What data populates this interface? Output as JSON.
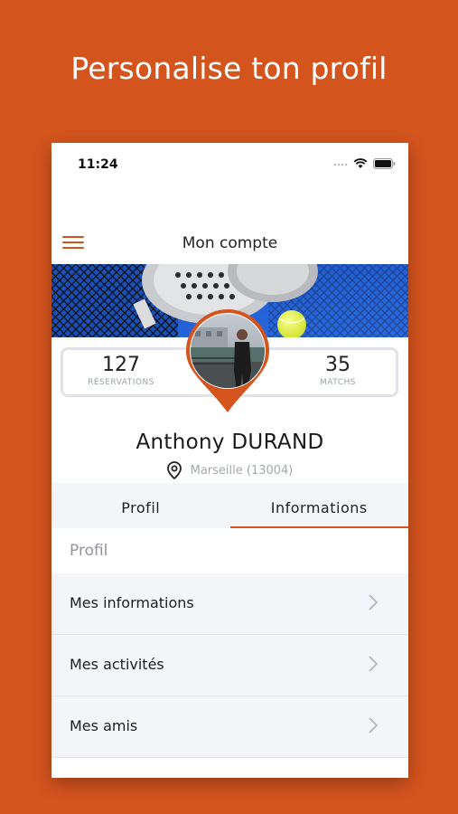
{
  "headline": "Personalise ton profil",
  "status_bar": {
    "time": "11:24"
  },
  "navbar": {
    "title": "Mon compte",
    "menu_icon": "hamburger-menu-icon"
  },
  "banner": {
    "subject": "padel racket, ball and net"
  },
  "stats": [
    {
      "value": "127",
      "label": "RÉSERVATIONS"
    },
    {
      "value": "35",
      "label": "MATCHS"
    }
  ],
  "profile": {
    "first_name": "Anthony",
    "last_name": "DURAND",
    "location": "Marseille (13004)",
    "location_icon": "map-pin-icon"
  },
  "tabs": [
    {
      "label": "Profil",
      "active": false
    },
    {
      "label": "Informations",
      "active": true
    }
  ],
  "section": {
    "title": "Profil"
  },
  "menu_items": [
    {
      "label": "Mes informations"
    },
    {
      "label": "Mes activités"
    },
    {
      "label": "Mes amis"
    }
  ],
  "colors": {
    "accent": "#d4541e",
    "background_light": "#f4f5f8",
    "muted_text": "#8f949b"
  }
}
